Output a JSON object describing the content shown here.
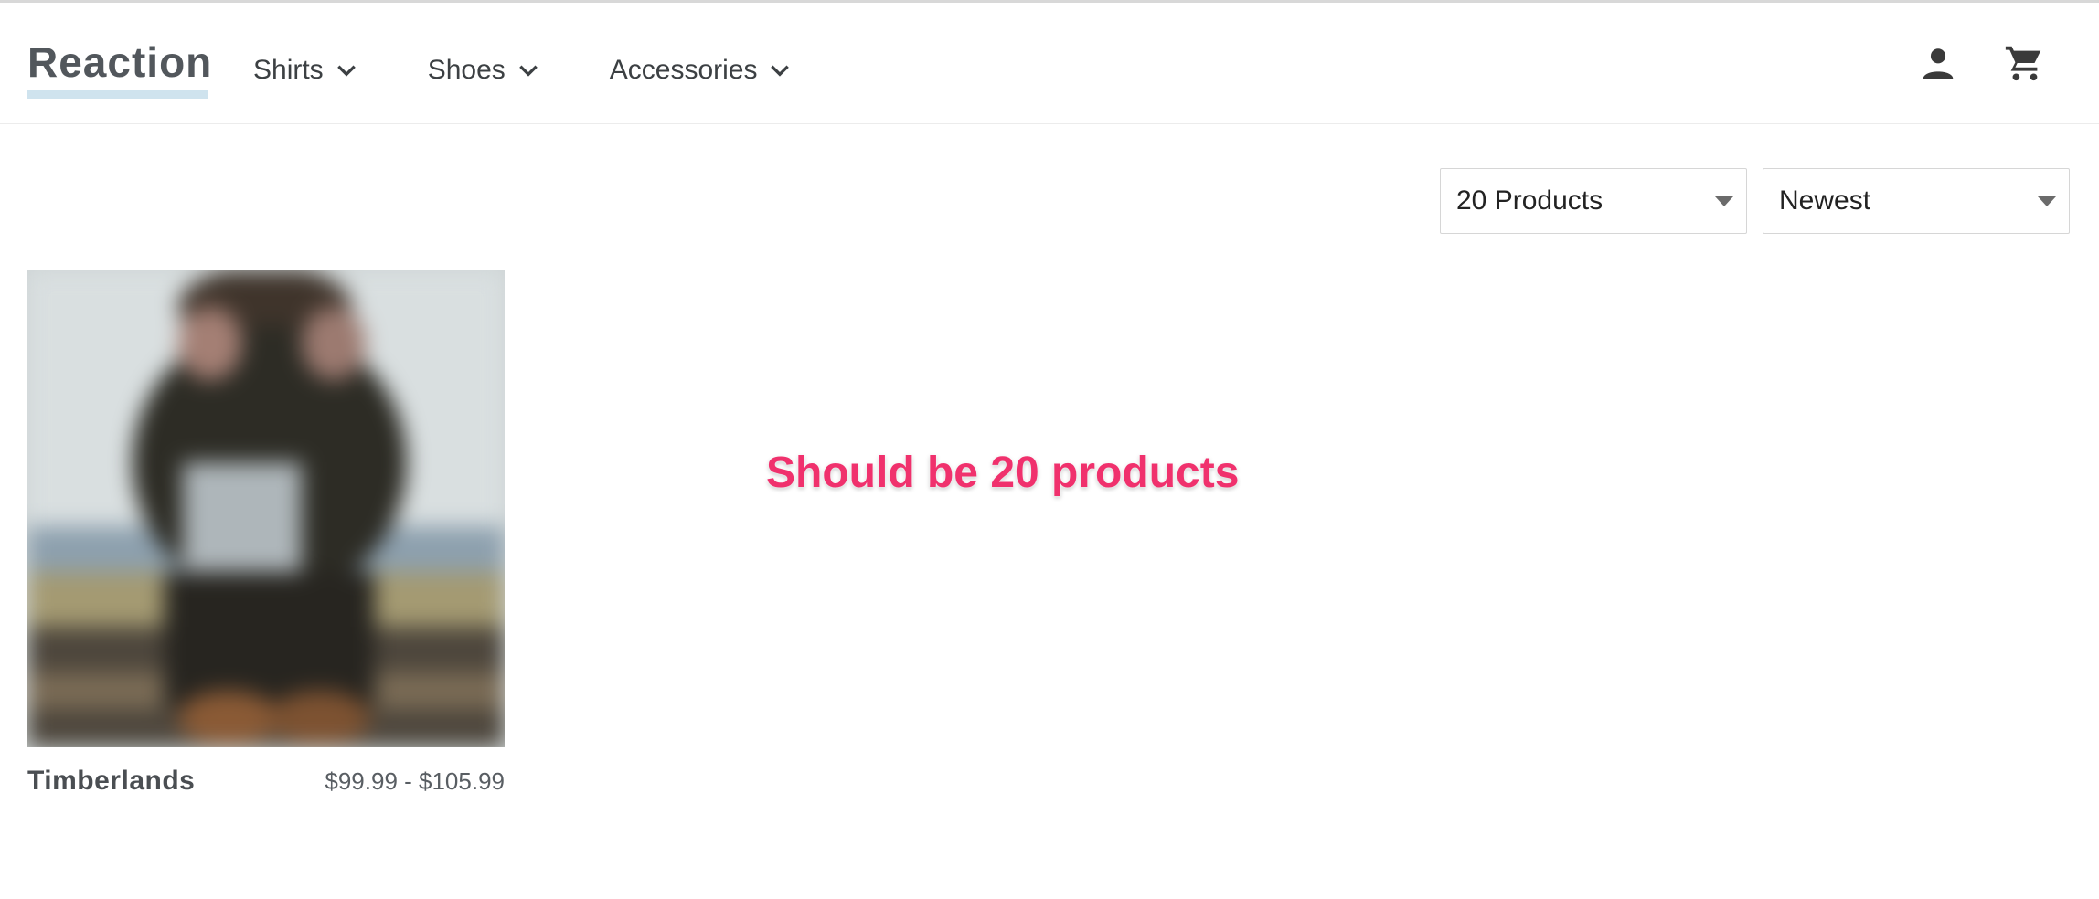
{
  "header": {
    "logo": "Reaction",
    "nav": [
      {
        "label": "Shirts",
        "icon": "chevron-down-icon"
      },
      {
        "label": "Shoes",
        "icon": "chevron-down-icon"
      },
      {
        "label": "Accessories",
        "icon": "chevron-down-icon"
      }
    ],
    "icons": {
      "account": "account-icon",
      "cart": "cart-icon"
    }
  },
  "toolbar": {
    "page_size": {
      "selected": "20 Products"
    },
    "sort": {
      "selected": "Newest"
    }
  },
  "products": [
    {
      "title": "Timberlands",
      "price": "$99.99 - $105.99"
    }
  ],
  "annotation": {
    "text": "Should be 20 products",
    "color": "#f0316d"
  },
  "colors": {
    "logo_underline": "#cfe3ee",
    "text": "#3c4043"
  }
}
